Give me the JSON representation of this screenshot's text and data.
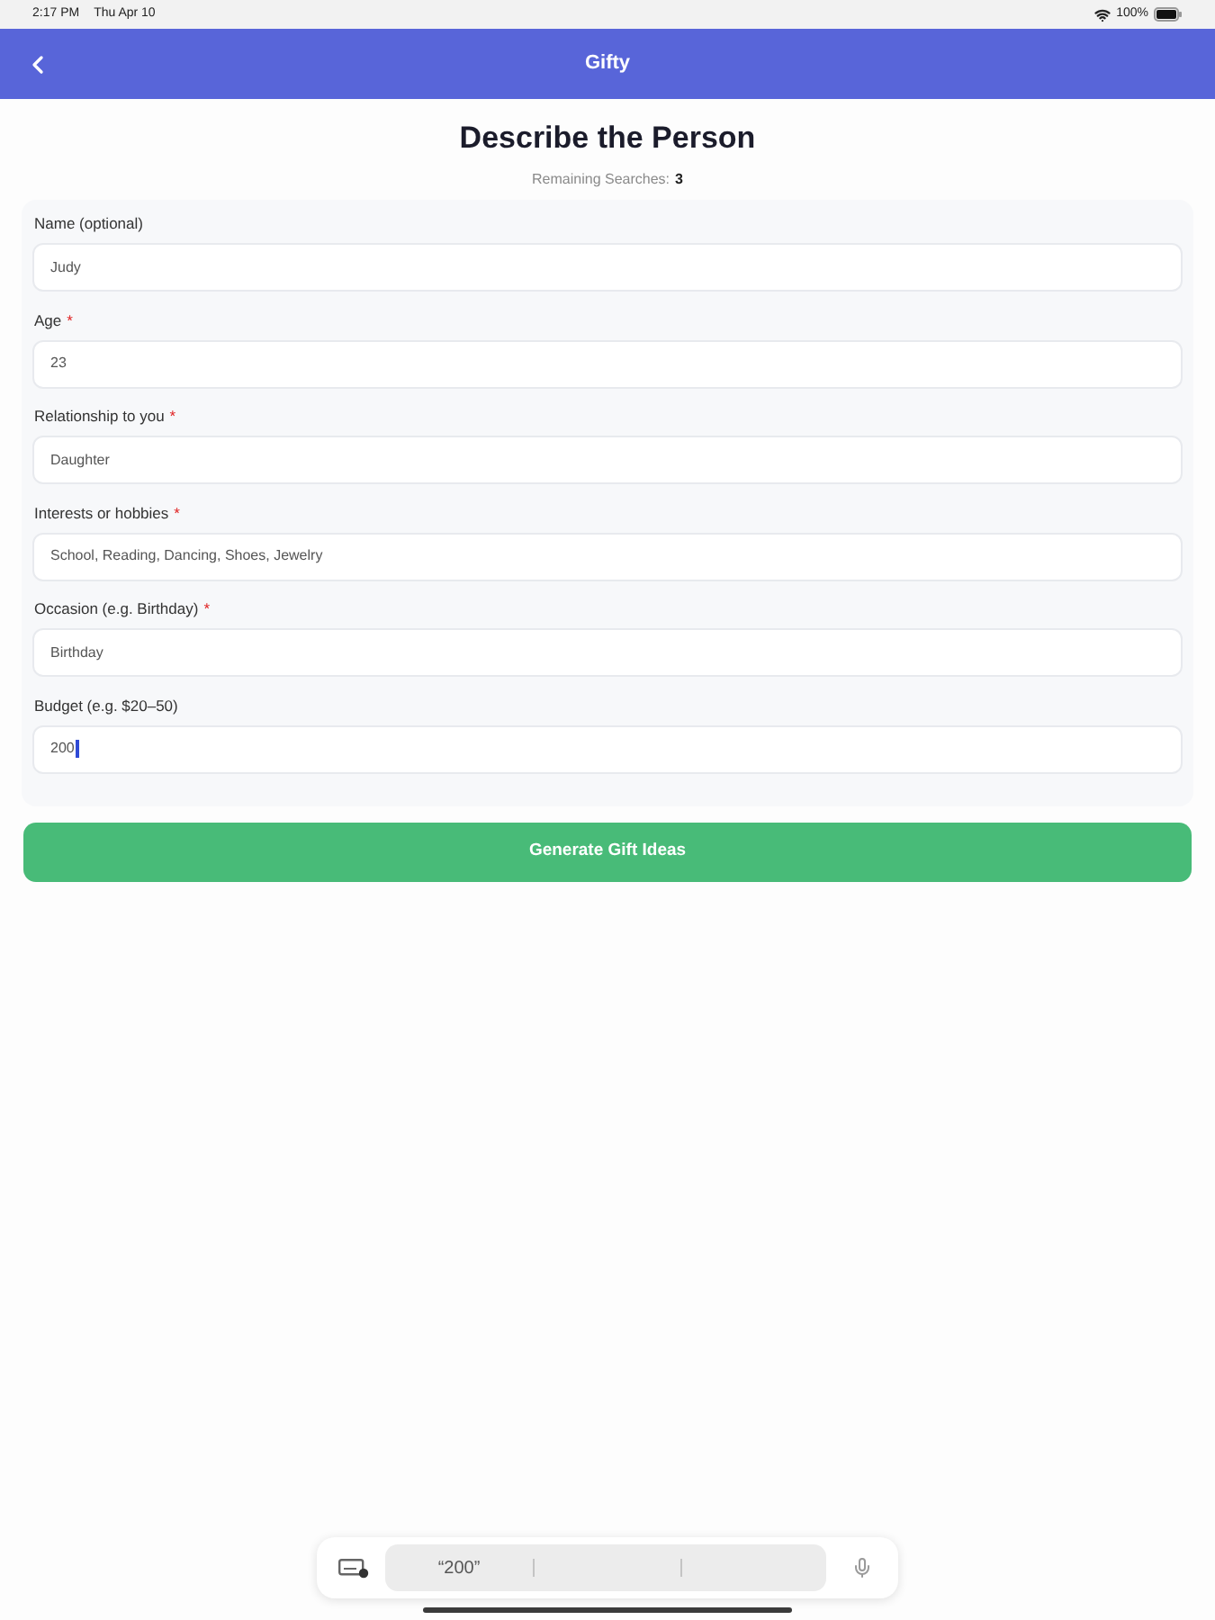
{
  "status_bar": {
    "time": "2:17 PM",
    "date": "Thu Apr 10",
    "battery": "100%"
  },
  "nav_bar": {
    "title": "Gifty"
  },
  "heading": "Describe the Person",
  "remaining": {
    "label": "Remaining Searches:",
    "count": "3"
  },
  "required_marker": "*",
  "fields": [
    {
      "label": "Name (optional)",
      "required": false,
      "value": "Judy",
      "focused": false
    },
    {
      "label": "Age",
      "required": true,
      "value": "23",
      "focused": false
    },
    {
      "label": "Relationship to you",
      "required": true,
      "value": "Daughter",
      "focused": false
    },
    {
      "label": "Interests or hobbies",
      "required": true,
      "value": "School, Reading, Dancing, Shoes, Jewelry",
      "focused": false
    },
    {
      "label": "Occasion (e.g. Birthday)",
      "required": true,
      "value": "Birthday",
      "focused": false
    },
    {
      "label": "Budget (e.g. $20–50)",
      "required": false,
      "value": "200",
      "focused": true
    }
  ],
  "submit_button": "Generate Gift Ideas",
  "keyboard_bar": {
    "suggestion": "“200”"
  }
}
